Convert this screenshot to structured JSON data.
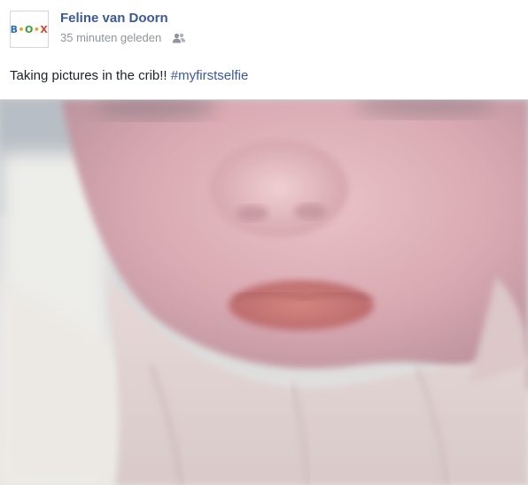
{
  "post": {
    "author": "Feline van Doorn",
    "timestamp": "35 minuten geleden",
    "audience_icon": "friends-icon",
    "text_main": "Taking pictures in the crib!! ",
    "hashtag": "#myfirstselfie"
  },
  "avatar": {
    "logo_parts": [
      "B",
      "•",
      "O",
      "•",
      "X"
    ]
  },
  "colors": {
    "link": "#3b5998",
    "meta": "#90949c",
    "text": "#1d2129"
  }
}
